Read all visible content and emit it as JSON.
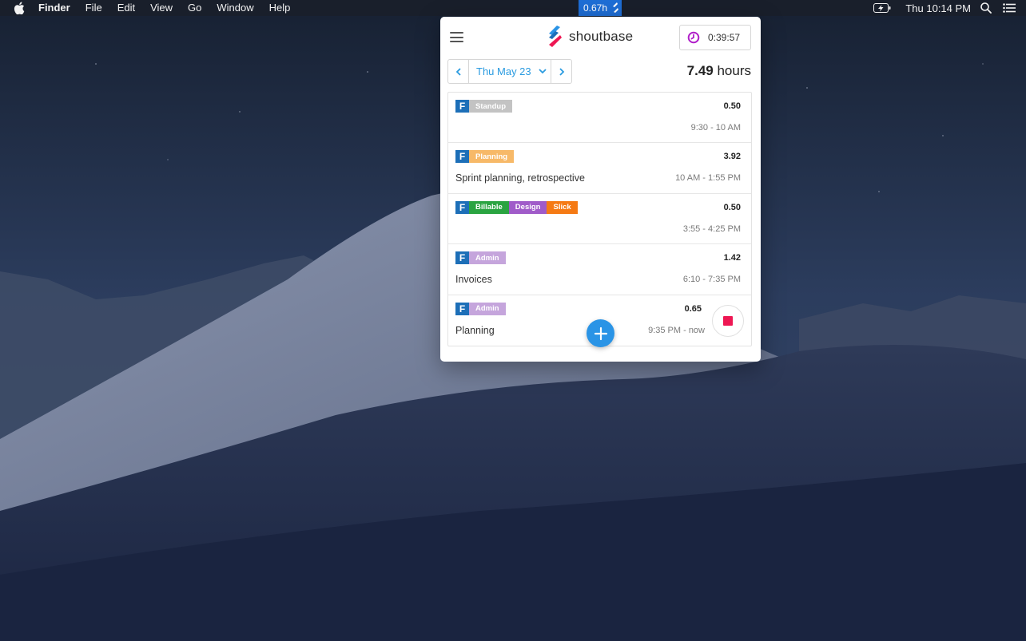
{
  "menubar": {
    "app_name": "Finder",
    "menus": [
      "File",
      "Edit",
      "View",
      "Go",
      "Window",
      "Help"
    ],
    "status_item_text": "0.67h",
    "clock": "Thu 10:14 PM"
  },
  "app": {
    "brand": "shoutbase",
    "timer": "0:39:57",
    "date_label": "Thu May 23",
    "total_hours": "7.49",
    "total_unit": "hours",
    "entries": [
      {
        "tags": [
          {
            "label": "Standup",
            "color": "#c3c3c3"
          }
        ],
        "hours": "0.50",
        "description": "",
        "time_range": "9:30 - 10 AM",
        "running": false
      },
      {
        "tags": [
          {
            "label": "Planning",
            "color": "#f7b968"
          }
        ],
        "hours": "3.92",
        "description": "Sprint planning, retrospective",
        "time_range": "10 AM - 1:55 PM",
        "running": false
      },
      {
        "tags": [
          {
            "label": "Billable",
            "color": "#2aa441"
          },
          {
            "label": "Design",
            "color": "#a05bc9"
          },
          {
            "label": "Slick",
            "color": "#f57a14"
          }
        ],
        "hours": "0.50",
        "description": "",
        "time_range": "3:55 - 4:25 PM",
        "running": false
      },
      {
        "tags": [
          {
            "label": "Admin",
            "color": "#c5a5dc"
          }
        ],
        "hours": "1.42",
        "description": "Invoices",
        "time_range": "6:10 - 7:35 PM",
        "running": false
      },
      {
        "tags": [
          {
            "label": "Admin",
            "color": "#c5a5dc"
          }
        ],
        "hours": "0.65",
        "description": "Planning",
        "time_range": "9:35 PM - now",
        "running": true
      }
    ],
    "project_badge": "F",
    "colors": {
      "accent": "#2a9be0",
      "project": "#1d6fb8",
      "stop": "#ee1753",
      "timer_icon": "#b01fc9"
    }
  }
}
